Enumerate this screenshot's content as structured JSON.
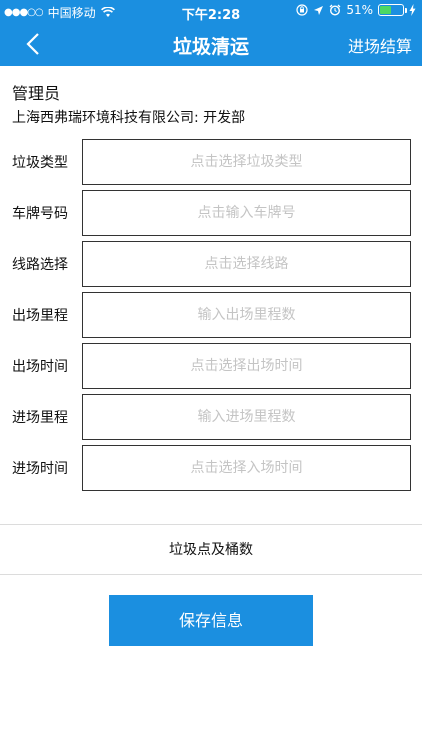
{
  "status_bar": {
    "carrier": "中国移动",
    "time": "下午2:28",
    "battery": "51%",
    "battery_level": 0.51,
    "icons": [
      "signal-dots-icon",
      "wifi-icon",
      "lock-rotation-icon",
      "location-arrow-icon",
      "alarm-icon",
      "battery-icon",
      "charging-icon"
    ]
  },
  "nav": {
    "back_icon": "chevron-left-icon",
    "title": "垃圾清运",
    "action": "进场结算"
  },
  "header": {
    "role": "管理员",
    "company": "上海西弗瑞环境科技有限公司: 开发部"
  },
  "form": {
    "rows": [
      {
        "label": "垃圾类型",
        "placeholder": "点击选择垃圾类型"
      },
      {
        "label": "车牌号码",
        "placeholder": "点击输入车牌号"
      },
      {
        "label": "线路选择",
        "placeholder": "点击选择线路"
      },
      {
        "label": "出场里程",
        "placeholder": "输入出场里程数"
      },
      {
        "label": "出场时间",
        "placeholder": "点击选择出场时间"
      },
      {
        "label": "进场里程",
        "placeholder": "输入进场里程数"
      },
      {
        "label": "进场时间",
        "placeholder": "点击选择入场时间"
      }
    ]
  },
  "count_section": {
    "label": "垃圾点及桶数"
  },
  "save_button": {
    "label": "保存信息"
  },
  "colors": {
    "primary": "#1b8fe0",
    "placeholder": "#c4c4c4",
    "battery_fill": "#4cd964"
  }
}
